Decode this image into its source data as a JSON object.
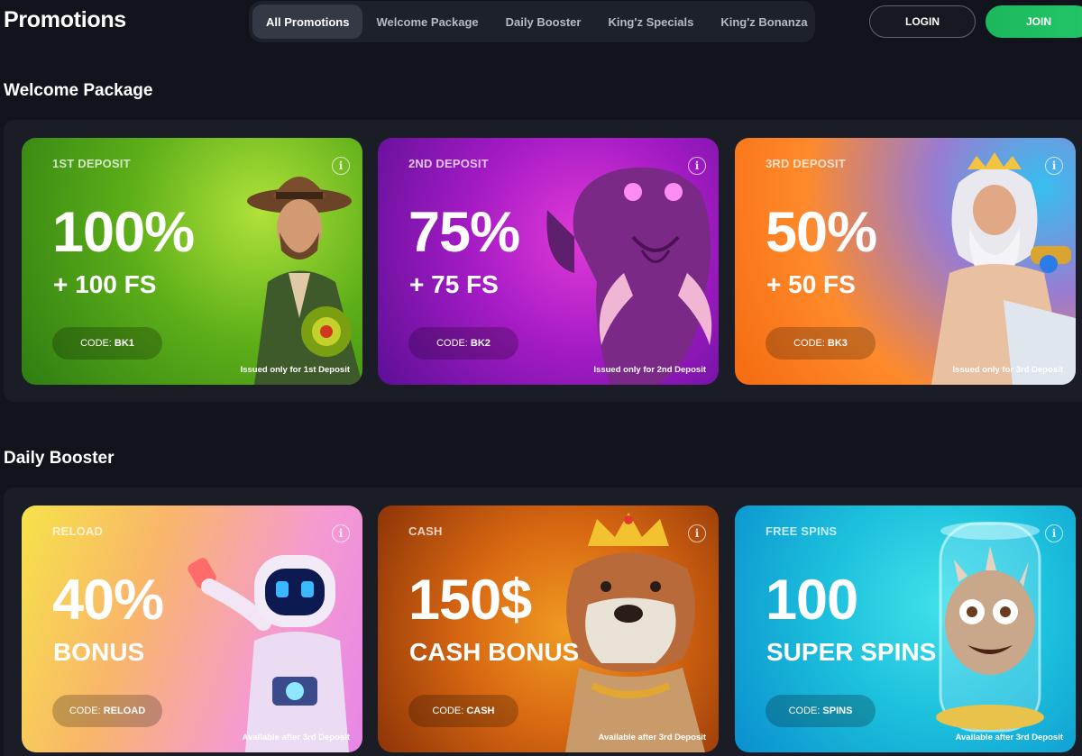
{
  "header": {
    "title": "Promotions",
    "tabs": [
      {
        "label": "All Promotions",
        "active": true
      },
      {
        "label": "Welcome Package",
        "active": false
      },
      {
        "label": "Daily Booster",
        "active": false
      },
      {
        "label": "King'z Specials",
        "active": false
      },
      {
        "label": "King'z Bonanza",
        "active": false
      }
    ],
    "login_label": "LOGIN",
    "join_label": "JOIN"
  },
  "welcome": {
    "title": "Welcome Package",
    "cards": [
      {
        "label": "1ST DEPOSIT",
        "big": "100%",
        "sub": "+ 100 FS",
        "code_prefix": "CODE:",
        "code": "BK1",
        "note": "Issued only for 1st Deposit",
        "icon": "cowboy-character"
      },
      {
        "label": "2ND DEPOSIT",
        "big": "75%",
        "sub": "+ 75 FS",
        "code_prefix": "CODE:",
        "code": "BK2",
        "note": "Issued only for 2nd Deposit",
        "icon": "elephant-character"
      },
      {
        "label": "3RD DEPOSIT",
        "big": "50%",
        "sub": "+ 50 FS",
        "code_prefix": "CODE:",
        "code": "BK3",
        "note": "Issued only for 3rd Deposit",
        "icon": "zeus-character"
      }
    ]
  },
  "daily": {
    "title": "Daily Booster",
    "cards": [
      {
        "label": "RELOAD",
        "big": "40%",
        "sub": "BONUS",
        "code_prefix": "CODE:",
        "code": "RELOAD",
        "note": "Available after 3rd Deposit",
        "icon": "astronaut-character"
      },
      {
        "label": "CASH",
        "big": "150$",
        "sub": "CASH BONUS",
        "code_prefix": "CODE:",
        "code": "CASH",
        "note": "Available after 3rd Deposit",
        "icon": "bulldog-king-character"
      },
      {
        "label": "FREE SPINS",
        "big": "100",
        "sub": "SUPER SPINS",
        "code_prefix": "CODE:",
        "code": "SPINS",
        "note": "Available after 3rd Deposit",
        "icon": "monster-in-jar-character"
      }
    ]
  },
  "info_icon_glyph": "i",
  "colors": {
    "background": "#11141c",
    "panel": "#1a1d26",
    "join": "#1cb85b",
    "card_green": "#5aa81e",
    "card_purple": "#a61bd0",
    "card_orange": "#f08a1e",
    "card_pink": "#f4a7b9",
    "card_brown": "#d26a12",
    "card_cyan": "#1fc4e0"
  }
}
